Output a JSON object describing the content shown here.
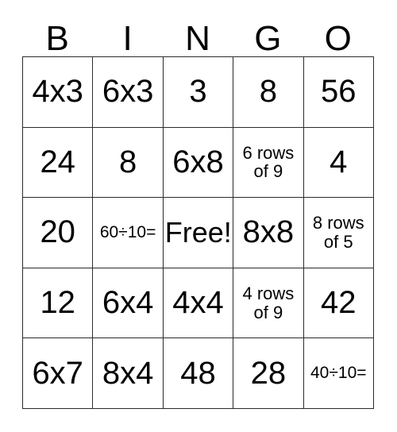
{
  "card": {
    "headers": [
      "B",
      "I",
      "N",
      "G",
      "O"
    ],
    "rows": [
      [
        {
          "text": "4x3",
          "size": "lg"
        },
        {
          "text": "6x3",
          "size": "lg"
        },
        {
          "text": "3",
          "size": "lg"
        },
        {
          "text": "8",
          "size": "lg"
        },
        {
          "text": "56",
          "size": "lg"
        }
      ],
      [
        {
          "text": "24",
          "size": "lg"
        },
        {
          "text": "8",
          "size": "lg"
        },
        {
          "text": "6x8",
          "size": "lg"
        },
        {
          "text": "6 rows of 9",
          "size": "sm"
        },
        {
          "text": "4",
          "size": "lg"
        }
      ],
      [
        {
          "text": "20",
          "size": "lg"
        },
        {
          "text": "60÷10=",
          "size": "xs"
        },
        {
          "text": "Free!",
          "size": "md"
        },
        {
          "text": "8x8",
          "size": "lg"
        },
        {
          "text": "8 rows of 5",
          "size": "sm"
        }
      ],
      [
        {
          "text": "12",
          "size": "lg"
        },
        {
          "text": "6x4",
          "size": "lg"
        },
        {
          "text": "4x4",
          "size": "lg"
        },
        {
          "text": "4 rows of 9",
          "size": "sm"
        },
        {
          "text": "42",
          "size": "lg"
        }
      ],
      [
        {
          "text": "6x7",
          "size": "lg"
        },
        {
          "text": "8x4",
          "size": "lg"
        },
        {
          "text": "48",
          "size": "lg"
        },
        {
          "text": "28",
          "size": "lg"
        },
        {
          "text": "40÷10=",
          "size": "xs"
        }
      ]
    ]
  },
  "colors": {
    "border": "#2b2b2b",
    "text": "#000000",
    "background": "#ffffff"
  }
}
